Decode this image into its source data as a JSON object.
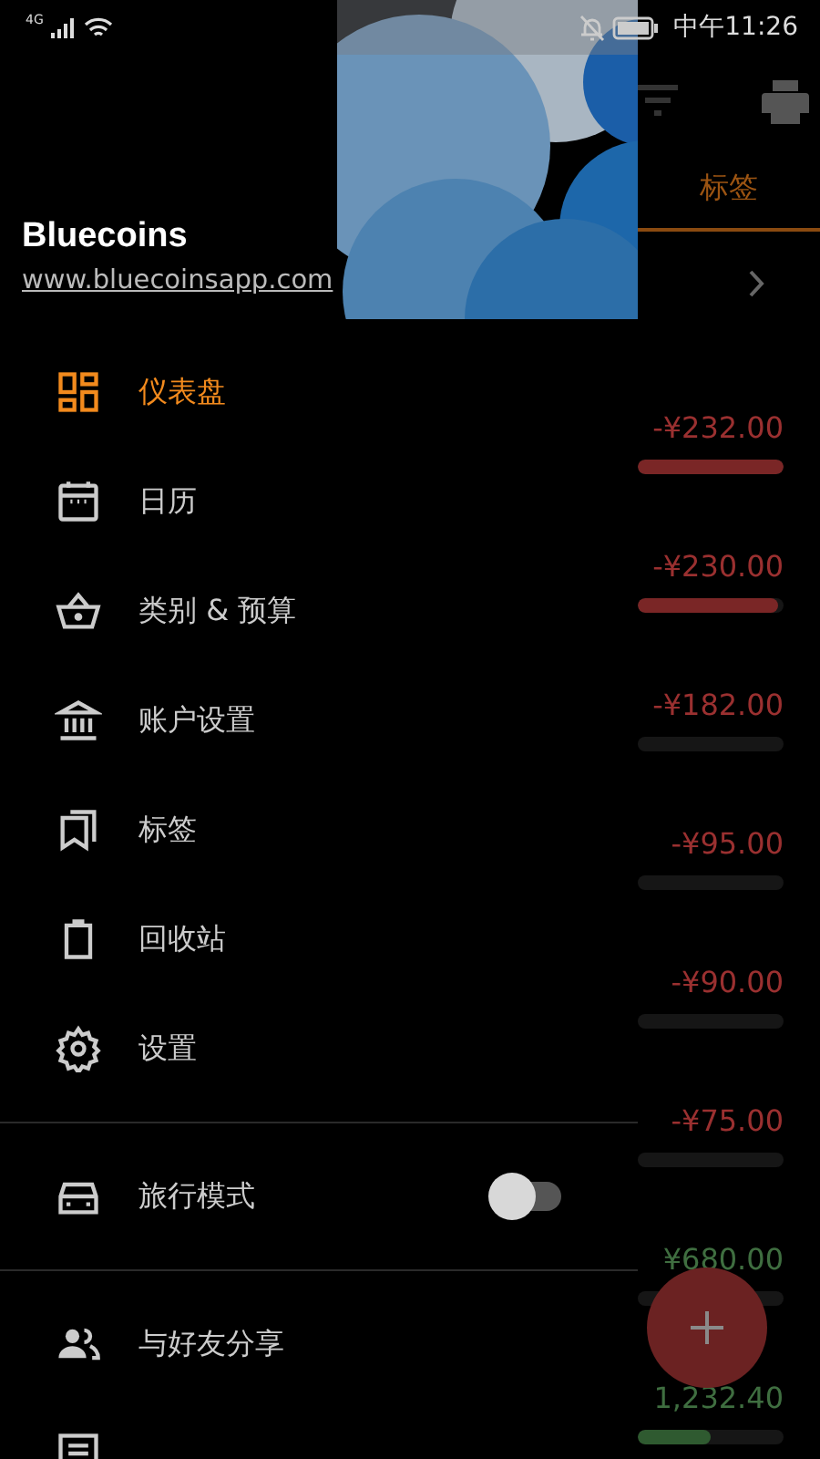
{
  "status_bar": {
    "network": "4G",
    "time": "中午11:26"
  },
  "drawer": {
    "app_name": "Bluecoins",
    "website": "www.bluecoinsapp.com",
    "items": [
      {
        "label": "仪表盘",
        "selected": true
      },
      {
        "label": "日历",
        "selected": false
      },
      {
        "label": "类别 & 预算",
        "selected": false
      },
      {
        "label": "账户设置",
        "selected": false
      },
      {
        "label": "标签",
        "selected": false
      },
      {
        "label": "回收站",
        "selected": false
      },
      {
        "label": "设置",
        "selected": false
      }
    ],
    "travel_mode": {
      "label": "旅行模式",
      "on": false
    },
    "more_items": [
      {
        "label": "与好友分享",
        "selected": false
      }
    ]
  },
  "background": {
    "tab": {
      "label": "标签",
      "selected": true
    },
    "amounts": [
      {
        "text": "-¥232.00",
        "kind": "expense",
        "level": 1
      },
      {
        "text": "-¥230.00",
        "kind": "expense",
        "level": 0.96
      },
      {
        "text": "-¥182.00",
        "kind": "expense",
        "level": 0
      },
      {
        "text": "-¥95.00",
        "kind": "expense",
        "level": 0
      },
      {
        "text": "-¥90.00",
        "kind": "expense",
        "level": 0
      },
      {
        "text": "-¥75.00",
        "kind": "expense",
        "level": 0
      },
      {
        "text": "¥680.00",
        "kind": "income",
        "level": 0
      },
      {
        "text": "1,232.40",
        "kind": "income",
        "level": 0.5
      }
    ]
  }
}
